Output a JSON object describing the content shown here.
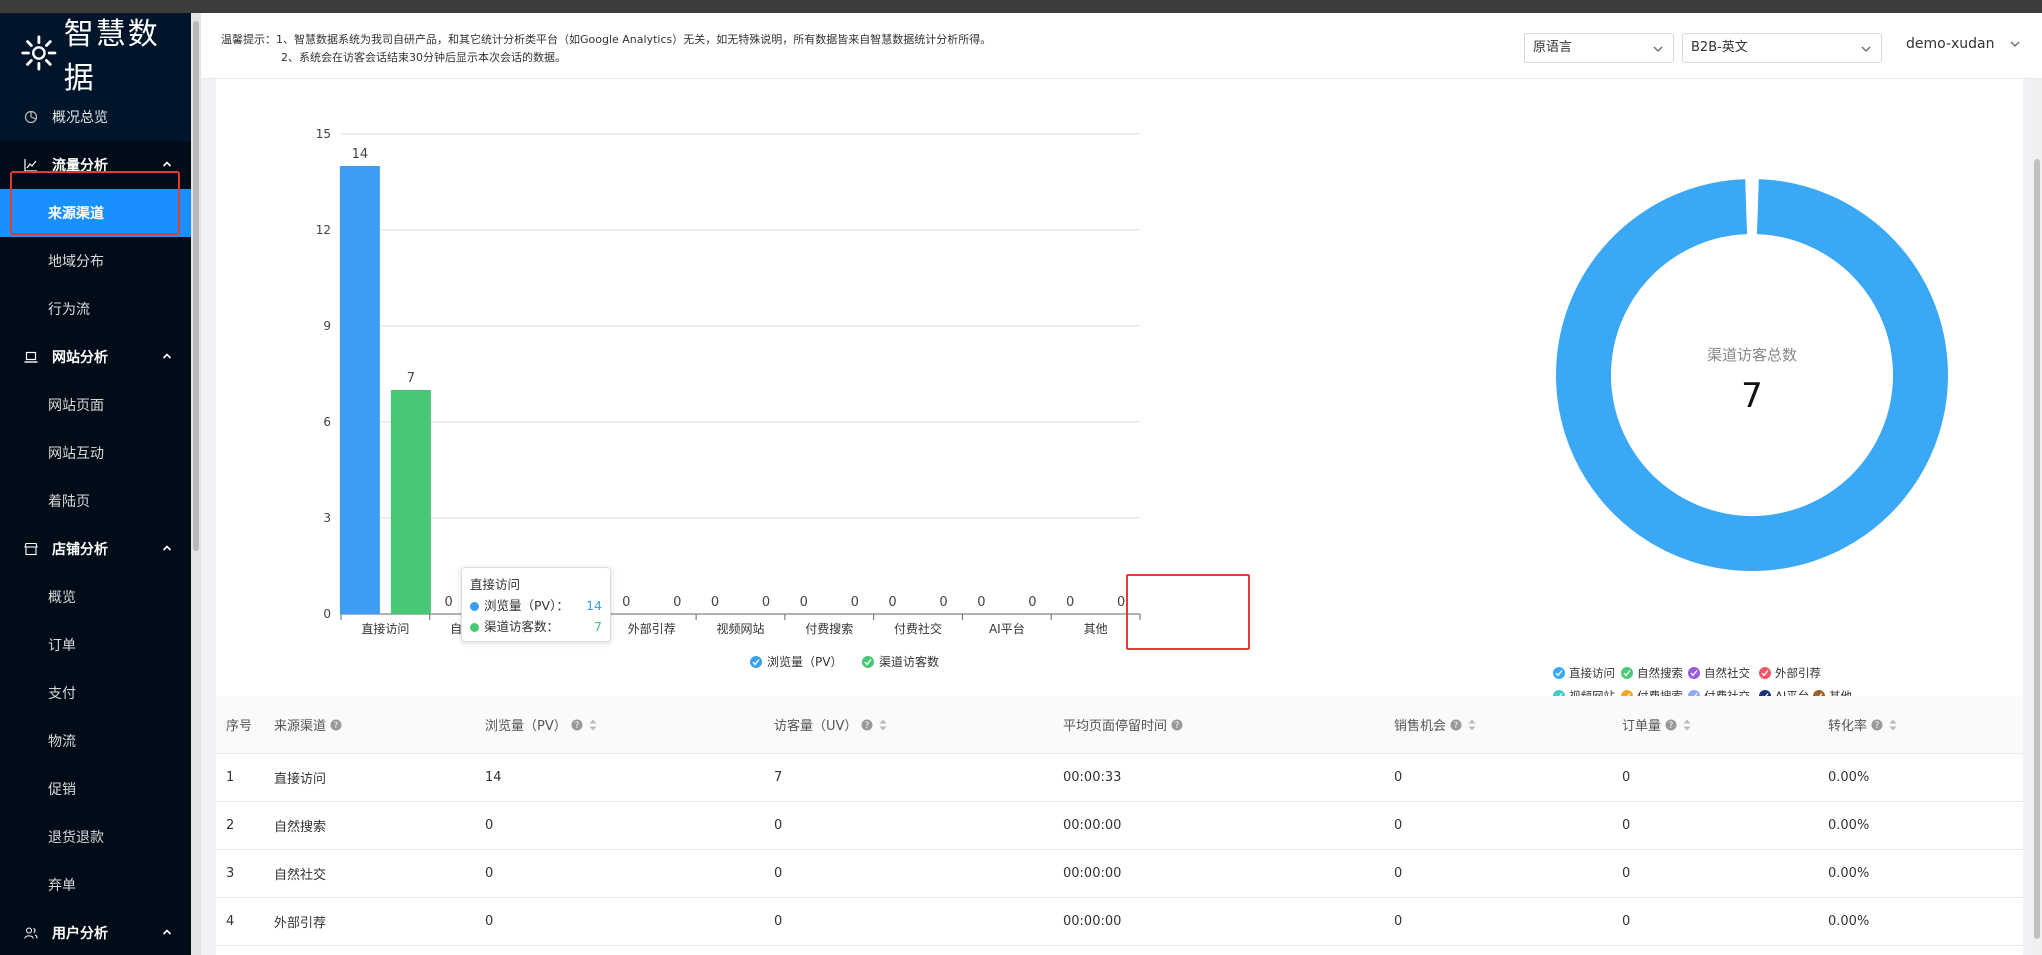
{
  "logo": {
    "text": "智慧数据",
    "icon": "sun-icon"
  },
  "sidebar": {
    "overview": {
      "label": "概况总览",
      "icon": "pie-chart-icon"
    },
    "groups": [
      {
        "label": "流量分析",
        "icon": "line-chart-icon",
        "items": [
          "来源渠道",
          "地域分布",
          "行为流"
        ]
      },
      {
        "label": "网站分析",
        "icon": "laptop-icon",
        "items": [
          "网站页面",
          "网站互动",
          "着陆页"
        ]
      },
      {
        "label": "店铺分析",
        "icon": "shop-icon",
        "items": [
          "概览",
          "订单",
          "支付",
          "物流",
          "促销",
          "退货退款",
          "弃单"
        ]
      },
      {
        "label": "用户分析",
        "icon": "user-group-icon",
        "items": []
      }
    ],
    "active_item": "来源渠道"
  },
  "header": {
    "notice_line1": "温馨提示：1、智慧数据系统为我司自研产品，和其它统计分析类平台（如Google Analytics）无关，如无特殊说明，所有数据皆来自智慧数据统计分析所得。",
    "notice_line2": "2、系统会在访客会话结束30分钟后显示本次会话的数据。",
    "language_select": "原语言",
    "site_select": "B2B-英文",
    "user": "demo-xudan"
  },
  "chart_data": [
    {
      "type": "bar",
      "categories": [
        "直接访问",
        "自然搜索",
        "自然社交",
        "外部引荐",
        "视频网站",
        "付费搜索",
        "付费社交",
        "AI平台",
        "其他"
      ],
      "series": [
        {
          "name": "浏览量（PV）",
          "values": [
            14,
            0,
            0,
            0,
            0,
            0,
            0,
            0,
            0
          ],
          "color": "#3d9df3"
        },
        {
          "name": "渠道访客数",
          "values": [
            7,
            0,
            0,
            0,
            0,
            0,
            0,
            0,
            0
          ],
          "color": "#48c774"
        }
      ],
      "ylim": [
        0,
        15
      ],
      "yticks": [
        0,
        3,
        6,
        9,
        12,
        15
      ],
      "grid": true,
      "legend": "bottom"
    },
    {
      "type": "pie",
      "title": "渠道访客总数",
      "total": "7",
      "slices": [
        {
          "name": "直接访问",
          "value": 7,
          "color": "#3ba8f5"
        },
        {
          "name": "自然搜索",
          "value": 0,
          "color": "#4cc97a"
        },
        {
          "name": "自然社交",
          "value": 0,
          "color": "#9b59d6"
        },
        {
          "name": "外部引荐",
          "value": 0,
          "color": "#f2566a"
        },
        {
          "name": "视频网站",
          "value": 0,
          "color": "#3ccfcf"
        },
        {
          "name": "付费搜索",
          "value": 0,
          "color": "#f5a623"
        },
        {
          "name": "付费社交",
          "value": 0,
          "color": "#8fa8f5"
        },
        {
          "name": "AI平台",
          "value": 0,
          "color": "#1a2f7a"
        },
        {
          "name": "其他",
          "value": 0,
          "color": "#a0612b"
        }
      ],
      "legend": "bottom"
    }
  ],
  "tooltip": {
    "title": "直接访问",
    "rows": [
      {
        "label": "浏览量（PV）：",
        "value": "14",
        "color": "#3d9df3"
      },
      {
        "label": "渠道访客数：",
        "value": "7",
        "color": "#48c774"
      }
    ]
  },
  "table": {
    "columns": [
      "序号",
      "来源渠道",
      "浏览量（PV）",
      "访客量（UV）",
      "平均页面停留时间",
      "销售机会",
      "订单量",
      "转化率"
    ],
    "rows": [
      [
        "1",
        "直接访问",
        "14",
        "7",
        "00:00:33",
        "0",
        "0",
        "0.00%"
      ],
      [
        "2",
        "自然搜索",
        "0",
        "0",
        "00:00:00",
        "0",
        "0",
        "0.00%"
      ],
      [
        "3",
        "自然社交",
        "0",
        "0",
        "00:00:00",
        "0",
        "0",
        "0.00%"
      ],
      [
        "4",
        "外部引荐",
        "0",
        "0",
        "00:00:00",
        "0",
        "0",
        "0.00%"
      ]
    ]
  },
  "colors": {
    "sidebar_bg": "#001529",
    "active": "#1890ff",
    "highlight": "#e53935"
  }
}
